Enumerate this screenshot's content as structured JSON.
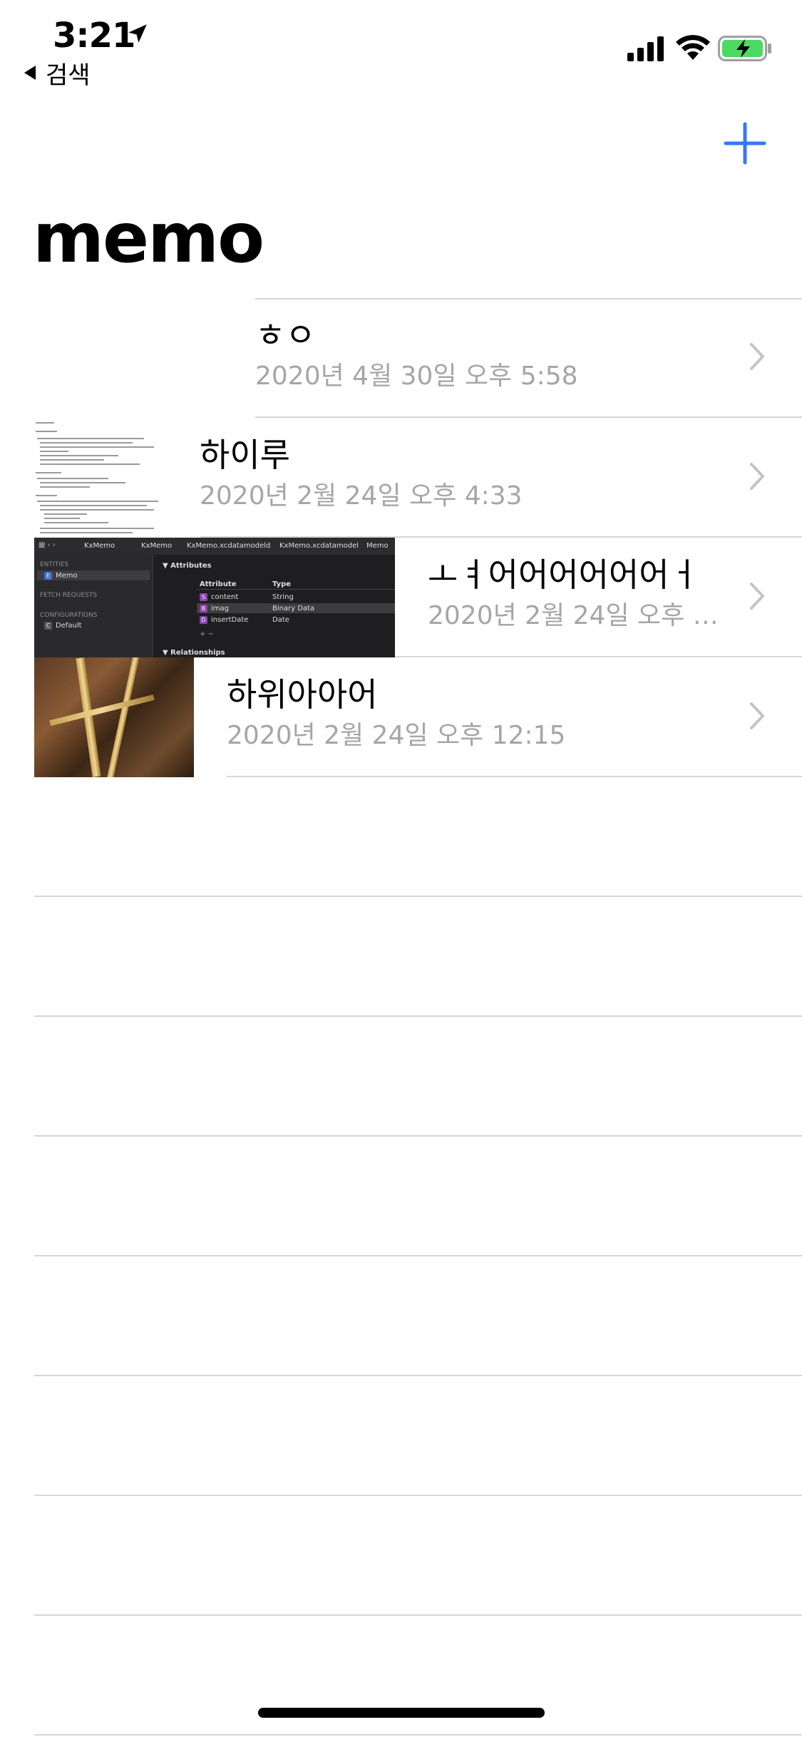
{
  "status_bar": {
    "time": "3:21",
    "back_label": "검색",
    "battery_color": "#4cd964"
  },
  "nav": {
    "title": "memo",
    "add_icon": "plus-icon",
    "accent_color": "#3478f6"
  },
  "memos": [
    {
      "title": "ㅎㅇ",
      "date": "2020년 4월 30일 오후 5:58",
      "thumbnail": "none"
    },
    {
      "title": "하이루",
      "date": "2020년 2월 24일 오후 4:33",
      "thumbnail": "document-screenshot"
    },
    {
      "title": "ㅗㅕ어어어어어어ㅓ",
      "date": "2020년 2월 24일 오후 12...",
      "thumbnail": "xcode-screenshot",
      "xcode": {
        "breadcrumbs": [
          "KxMemo",
          "KxMemo",
          "KxMemo.xcdatamodeld",
          "KxMemo.xcdatamodel",
          "Memo"
        ],
        "sections": [
          "ENTITIES",
          "FETCH REQUESTS",
          "CONFIGURATIONS"
        ],
        "entity": "Memo",
        "configuration": "Default",
        "panel_title": "Attributes",
        "col_attribute": "Attribute",
        "col_type": "Type",
        "attributes": [
          {
            "badge": "S",
            "name": "content",
            "type": "String"
          },
          {
            "badge": "B",
            "name": "imag",
            "type": "Binary Data"
          },
          {
            "badge": "D",
            "name": "insertDate",
            "type": "Date"
          }
        ],
        "relationships": "Relationships"
      }
    },
    {
      "title": "하위아아어",
      "date": "2020년 2월 24일 오후 12:15",
      "thumbnail": "photo"
    }
  ],
  "empty_row_count": 8
}
